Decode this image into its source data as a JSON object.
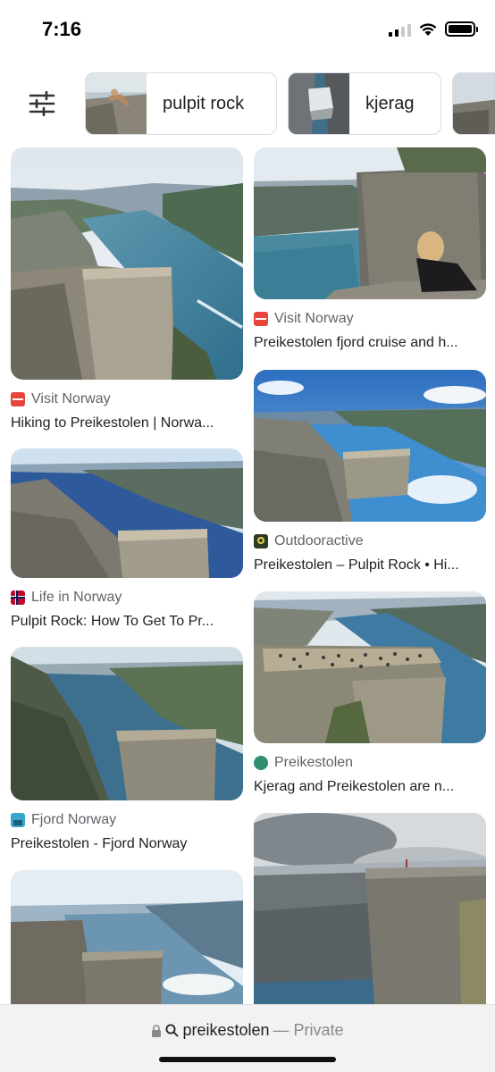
{
  "status_bar": {
    "time": "7:16"
  },
  "chips": [
    {
      "label": "pulpit rock"
    },
    {
      "label": "kjerag"
    },
    {
      "label": ""
    }
  ],
  "results": [
    {
      "source": "Visit Norway",
      "title": "Hiking to Preikestolen | Norwa...",
      "icon_color": "#e8453c"
    },
    {
      "source": "Visit Norway",
      "title": "Preikestolen fjord cruise and h...",
      "icon_color": "#e8453c"
    },
    {
      "source": "Life in Norway",
      "title": "Pulpit Rock: How To Get To Pr...",
      "icon_color": "#ba0c2f"
    },
    {
      "source": "Outdooractive",
      "title": "Preikestolen – Pulpit Rock • Hi...",
      "icon_color": "#2e3a23"
    },
    {
      "source": "Fjord Norway",
      "title": "Preikestolen - Fjord Norway",
      "icon_color": "#3aa6c9"
    },
    {
      "source": "Preikestolen",
      "title": "Kjerag and Preikestolen are n...",
      "icon_color": "#2d8f6f"
    }
  ],
  "bottom_bar": {
    "query": "preikestolen",
    "mode": "— Private"
  }
}
